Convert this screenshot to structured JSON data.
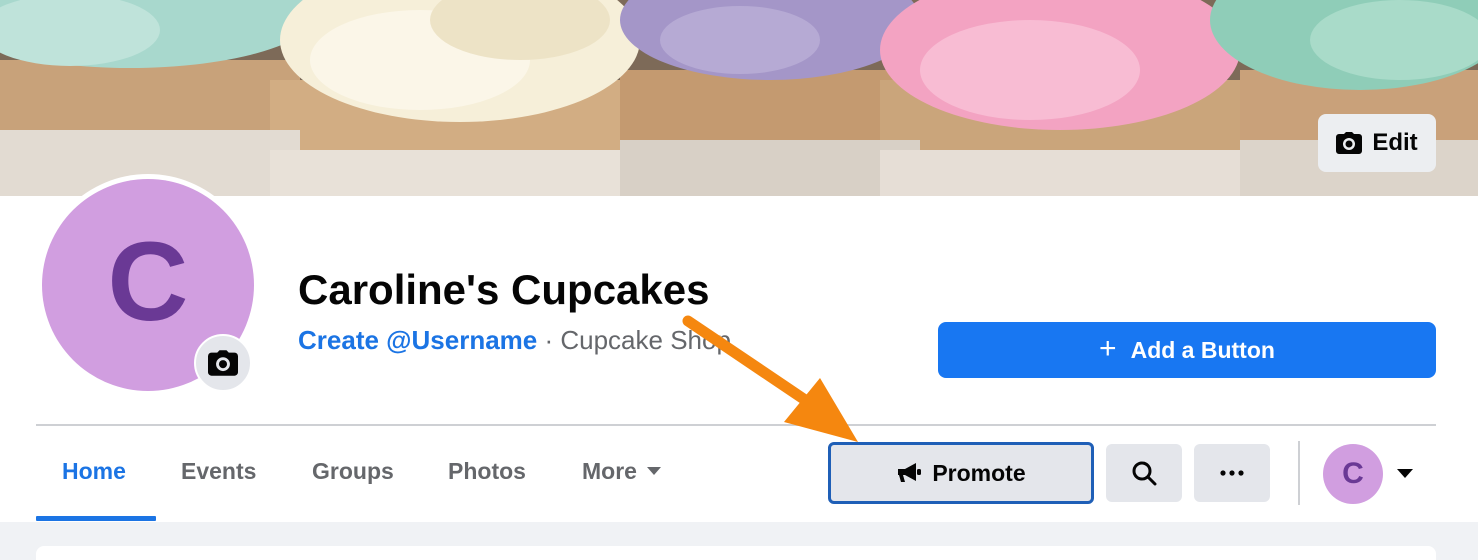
{
  "cover": {
    "edit_label": "Edit",
    "edit_icon": "camera-icon"
  },
  "profile": {
    "avatar_letter": "C",
    "avatar_color": "#d19ee0",
    "avatar_letter_color": "#6a3995",
    "camera_icon": "camera-icon",
    "name": "Caroline's Cupcakes",
    "username_link": "Create @Username",
    "separator": " · ",
    "category": "Cupcake Shop"
  },
  "actions": {
    "add_button_label": "Add a Button",
    "add_button_icon": "plus-icon",
    "promote_label": "Promote",
    "promote_icon": "megaphone-icon",
    "search_icon": "search-icon",
    "more_icon": "ellipsis-icon",
    "mini_avatar_letter": "C",
    "dropdown_icon": "caret-down-icon"
  },
  "tabs": [
    {
      "label": "Home",
      "active": true
    },
    {
      "label": "Events",
      "active": false
    },
    {
      "label": "Groups",
      "active": false
    },
    {
      "label": "Photos",
      "active": false
    },
    {
      "label": "More",
      "active": false
    }
  ],
  "colors": {
    "accent_blue": "#1877f2",
    "link_blue": "#1b74e4",
    "annotation_orange": "#f5870f",
    "button_grey": "#e4e6eb"
  }
}
